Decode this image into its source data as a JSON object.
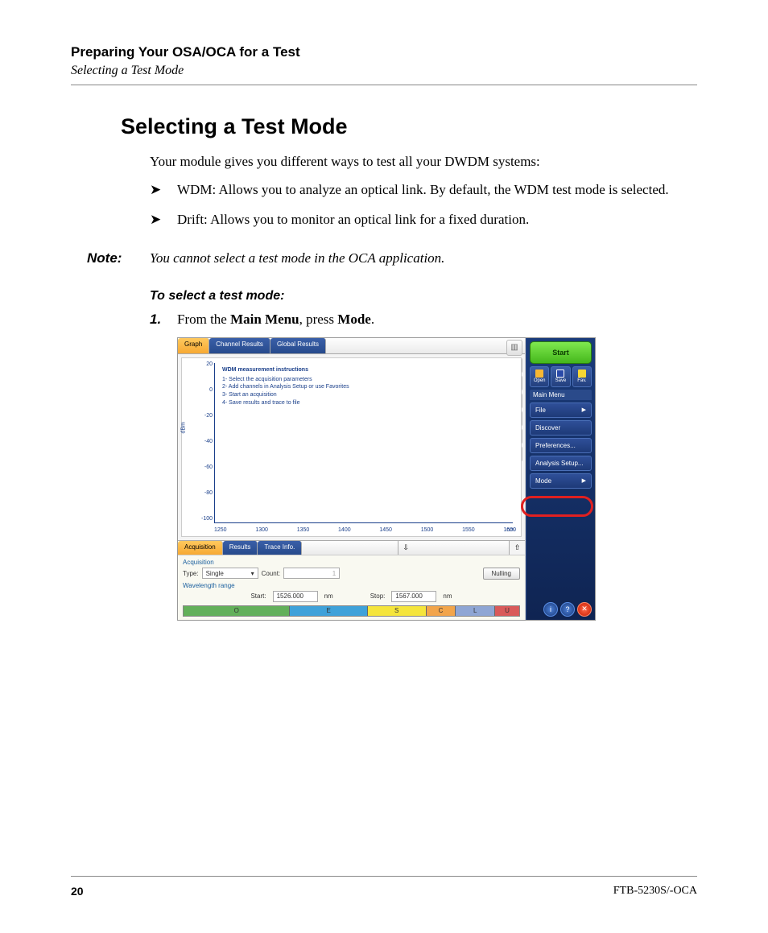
{
  "header": {
    "chapter": "Preparing Your OSA/OCA for a Test",
    "section": "Selecting a Test Mode"
  },
  "title": "Selecting a Test Mode",
  "intro": "Your module gives you different ways to test all your DWDM systems:",
  "bullets": [
    "WDM: Allows you to analyze an optical link. By default, the WDM test mode is selected.",
    "Drift: Allows you to monitor an optical link for a fixed duration."
  ],
  "note": {
    "label": "Note:",
    "body": "You cannot select a test mode in the OCA application."
  },
  "procedure_title": "To select a test mode:",
  "step1": {
    "num": "1.",
    "pre": "From the ",
    "b1": "Main Menu",
    "mid": ", press ",
    "b2": "Mode",
    "post": "."
  },
  "screenshot": {
    "tabs_top": {
      "graph": "Graph",
      "channel": "Channel Results",
      "global": "Global Results"
    },
    "graph": {
      "ylabel": "dBm",
      "yticks": [
        "20",
        "0",
        "-20",
        "-40",
        "-60",
        "-80",
        "-100"
      ],
      "xticks": [
        "1250",
        "1300",
        "1350",
        "1400",
        "1450",
        "1500",
        "1550",
        "1600"
      ],
      "xunit": "nm",
      "instr_title": "WDM measurement instructions",
      "instr_lines": [
        "1- Select the acquisition parameters",
        "2- Add channels in Analysis Setup or use Favorites",
        "3- Start an acquisition",
        "4- Save results and trace to file"
      ]
    },
    "tabs_bottom": {
      "acq": "Acquisition",
      "results": "Results",
      "trace": "Trace Info."
    },
    "acq": {
      "section": "Acquisition",
      "type_label": "Type:",
      "type_value": "Single",
      "count_label": "Count:",
      "count_value": "1",
      "nulling": "Nulling",
      "wrange_label": "Wavelength range",
      "start_label": "Start:",
      "start_value": "1526.000",
      "stop_label": "Stop:",
      "stop_value": "1567.000",
      "unit": "nm",
      "bands": [
        {
          "l": "O",
          "c": "#63b05a"
        },
        {
          "l": "E",
          "c": "#3fa2d9"
        },
        {
          "l": "S",
          "c": "#f5e53a"
        },
        {
          "l": "C",
          "c": "#f2a54a"
        },
        {
          "l": "L",
          "c": "#8fa6d4"
        },
        {
          "l": "U",
          "c": "#d95a5a"
        }
      ]
    },
    "sidebar": {
      "start": "Start",
      "open": "Open",
      "save": "Save",
      "fav": "Fav.",
      "menu_header": "Main Menu",
      "items": [
        {
          "label": "File",
          "arrow": true
        },
        {
          "label": "Discover",
          "arrow": false
        },
        {
          "label": "Preferences...",
          "arrow": false
        },
        {
          "label": "Analysis Setup...",
          "arrow": false
        },
        {
          "label": "Mode",
          "arrow": true
        }
      ],
      "info_icon": "i",
      "help_icon": "?",
      "close_icon": "✕"
    }
  },
  "footer": {
    "page": "20",
    "doc": "FTB-5230S/-OCA"
  },
  "chart_data": {
    "type": "line",
    "title": "WDM measurement instructions",
    "xlabel": "nm",
    "ylabel": "dBm",
    "xlim": [
      1250,
      1650
    ],
    "ylim": [
      -100,
      20
    ],
    "x": [],
    "series": [],
    "note": "No trace data plotted in screenshot; chart area shows only axes and instruction text."
  }
}
